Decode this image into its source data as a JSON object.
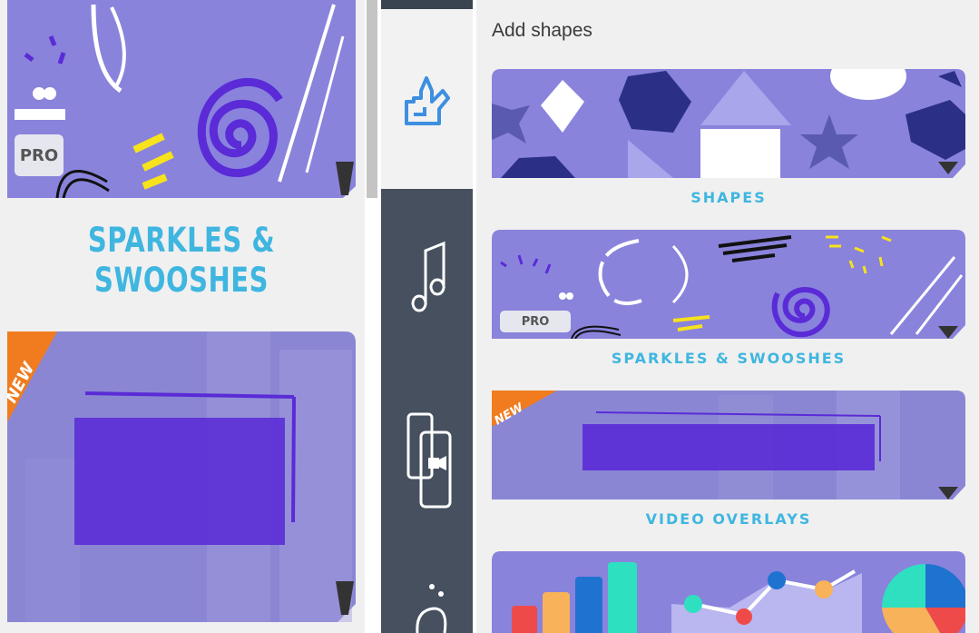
{
  "panel": {
    "title": "Add shapes"
  },
  "categories": [
    {
      "label": "SHAPES"
    },
    {
      "label": "SPARKLES & SWOOSHES",
      "badge": "PRO"
    },
    {
      "label": "VIDEO OVERLAYS",
      "badge": "NEW"
    },
    {
      "label": ""
    }
  ],
  "left_zoom": {
    "label": "SPARKLES & SWOOSHES",
    "pro_badge": "PRO",
    "new_badge": "NEW"
  },
  "toolbar_icons": [
    "shapes-icon",
    "music-icon",
    "video-overlay-icon",
    "effects-icon"
  ],
  "colors": {
    "card_bg": "#8983dc",
    "label": "#3fb6e0",
    "sidebar": "#46505e",
    "accent_blue": "#3d8fe0",
    "new_ribbon": "#f07c1f"
  }
}
